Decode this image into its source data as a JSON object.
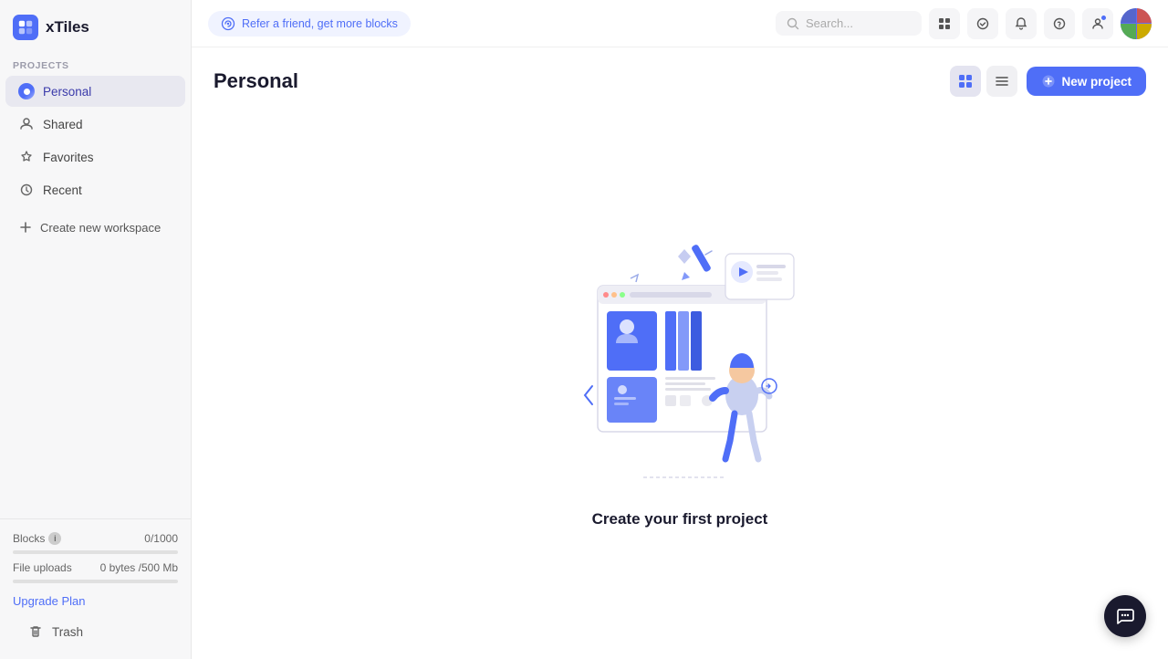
{
  "app": {
    "name": "xTiles",
    "logo_alt": "xTiles logo"
  },
  "sidebar": {
    "section_label": "PROJECTS",
    "nav_items": [
      {
        "id": "personal",
        "label": "Personal",
        "active": true
      },
      {
        "id": "shared",
        "label": "Shared",
        "active": false
      },
      {
        "id": "favorites",
        "label": "Favorites",
        "active": false
      },
      {
        "id": "recent",
        "label": "Recent",
        "active": false
      }
    ],
    "create_workspace_label": "Create new workspace",
    "blocks_label": "Blocks",
    "blocks_value": "0",
    "blocks_max": "/1000",
    "blocks_percent": 0,
    "file_uploads_label": "File uploads",
    "file_uploads_value": "0 bytes",
    "file_uploads_max": "/500 Mb",
    "upgrade_label": "Upgrade Plan",
    "trash_label": "Trash"
  },
  "topbar": {
    "refer_label": "Refer a friend, get more blocks",
    "search_placeholder": "Search...",
    "icons": [
      "grid-icon",
      "check-circle-icon",
      "bell-icon",
      "help-icon"
    ]
  },
  "page": {
    "title": "Personal",
    "view_grid_label": "Grid view",
    "view_list_label": "List view",
    "new_project_label": "New project",
    "empty_state_label": "Create your first project"
  },
  "chat_btn_label": "Chat support"
}
